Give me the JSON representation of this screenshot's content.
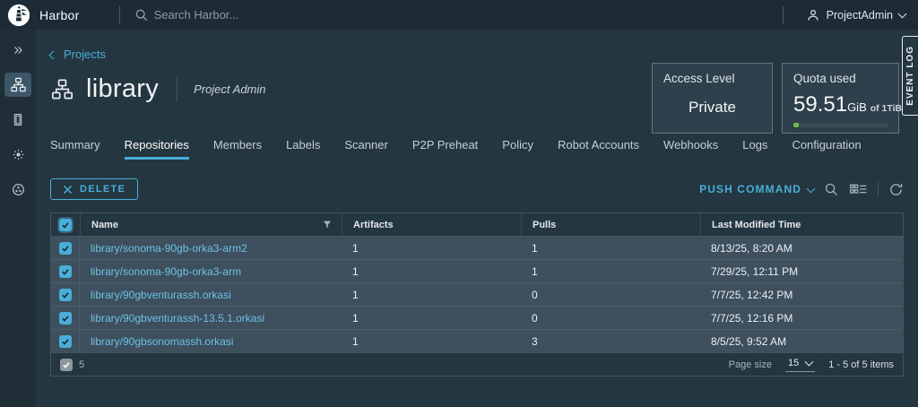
{
  "topbar": {
    "brand": "Harbor",
    "search_placeholder": "Search Harbor...",
    "user": "ProjectAdmin"
  },
  "sidebar": {
    "icons": [
      "expand-double-chevron",
      "projects",
      "logs",
      "interrogation",
      "distribution"
    ]
  },
  "breadcrumb": {
    "label": "Projects"
  },
  "project": {
    "name": "library",
    "role": "Project Admin"
  },
  "panels": {
    "access": {
      "label": "Access Level",
      "value": "Private"
    },
    "quota": {
      "label": "Quota used",
      "used": "59.51",
      "unit": "GiB",
      "limit": "of 1TiB",
      "percent": 6
    }
  },
  "event_log": {
    "label": "EVENT LOG"
  },
  "tabs": {
    "items": [
      "Summary",
      "Repositories",
      "Members",
      "Labels",
      "Scanner",
      "P2P Preheat",
      "Policy",
      "Robot Accounts",
      "Webhooks",
      "Logs",
      "Configuration"
    ],
    "active": "Repositories"
  },
  "toolbar": {
    "delete_label": "DELETE",
    "push_command_label": "PUSH COMMAND"
  },
  "repo_table": {
    "columns": [
      "Name",
      "Artifacts",
      "Pulls",
      "Last Modified Time"
    ],
    "rows": [
      {
        "name": "library/sonoma-90gb-orka3-arm2",
        "artifacts": "1",
        "pulls": "1",
        "modified": "8/13/25, 8:20 AM"
      },
      {
        "name": "library/sonoma-90gb-orka3-arm",
        "artifacts": "1",
        "pulls": "1",
        "modified": "7/29/25, 12:11 PM"
      },
      {
        "name": "library/90gbventurassh.orkasi",
        "artifacts": "1",
        "pulls": "0",
        "modified": "7/7/25, 12:42 PM"
      },
      {
        "name": "library/90gbventurassh-13.5.1.orkasi",
        "artifacts": "1",
        "pulls": "0",
        "modified": "7/7/25, 12:16 PM"
      },
      {
        "name": "library/90gbsonomassh.orkasi",
        "artifacts": "1",
        "pulls": "3",
        "modified": "8/5/25, 9:52 AM"
      }
    ],
    "footer": {
      "selected_count": "5",
      "page_size_label": "Page size",
      "page_size": "15",
      "range": "1 - 5 of 5 items"
    }
  },
  "colors": {
    "accent": "#49afd9",
    "link": "#6cc1e6",
    "quota_green": "#6cbe45",
    "topbar_bg": "#1c2b36",
    "content_bg": "#24363f",
    "row_bg": "#3e4f5d"
  }
}
